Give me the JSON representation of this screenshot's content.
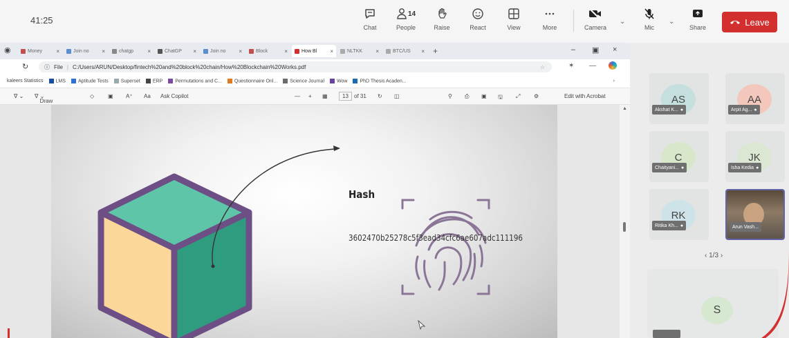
{
  "meeting": {
    "timer": "41:25",
    "controls": [
      {
        "name": "chat",
        "label": "Chat",
        "icon": "chat-icon"
      },
      {
        "name": "people",
        "label": "People",
        "icon": "people-icon",
        "count": "14"
      },
      {
        "name": "raise",
        "label": "Raise",
        "icon": "raise-hand-icon"
      },
      {
        "name": "react",
        "label": "React",
        "icon": "react-icon"
      },
      {
        "name": "view",
        "label": "View",
        "icon": "view-grid-icon"
      },
      {
        "name": "more",
        "label": "More",
        "icon": "more-icon"
      },
      {
        "name": "camera",
        "label": "Camera",
        "icon": "camera-off-icon"
      },
      {
        "name": "mic",
        "label": "Mic",
        "icon": "mic-off-icon"
      },
      {
        "name": "share",
        "label": "Share",
        "icon": "share-icon"
      }
    ],
    "leave_label": "Leave",
    "leave_color": "#d32f2f"
  },
  "browser": {
    "tabs": [
      {
        "label": "Money"
      },
      {
        "label": "Join no"
      },
      {
        "label": "chatgp"
      },
      {
        "label": "ChatGP"
      },
      {
        "label": "Join no"
      },
      {
        "label": "Block"
      },
      {
        "label": "How Bl",
        "active": true
      },
      {
        "label": "NLTKK"
      },
      {
        "label": "BTC/US"
      }
    ],
    "address": "C:/Users/ARUN/Desktop/fintech%20and%20block%20chain/How%20Blockchain%20Works.pdf",
    "address_prefix": "File",
    "favorites": [
      "kaleers Statistics",
      "LMS",
      "Aptitude Tests",
      "Superset",
      "ERP",
      "Permutations and C...",
      "Questionnaire Onl...",
      "Science Journal",
      "Wow",
      "PhD Thesis Acaden..."
    ],
    "pdf_toolbar": {
      "draw_label": "Draw",
      "copilot_label": "Ask Copilot",
      "page_current": "13",
      "page_total": "of 31",
      "acrobat_label": "Edit with Acrobat"
    }
  },
  "slide": {
    "hash_title": "Hash",
    "hash_value": "3602470b25278c5f3ead34cfc6ae607adc111196",
    "cube_colors": {
      "top": "#5fc5a8",
      "left": "#fbd899",
      "right": "#2f9c80",
      "outline": "#6d4f86"
    },
    "fingerprint_color": "#8a7596"
  },
  "participants": {
    "tiles": [
      {
        "initials": "AS",
        "name": "Akshat K...",
        "bg": "#c5dede"
      },
      {
        "initials": "AA",
        "name": "Arpit Ag...",
        "bg": "#f3c7bc"
      },
      {
        "initials": "C",
        "name": "Chaityani...",
        "bg": "#d8e6c9"
      },
      {
        "initials": "JK",
        "name": "Isha Kedia",
        "bg": "#dbe7d2"
      },
      {
        "initials": "RK",
        "name": "Ritika Kh...",
        "bg": "#cde3e8"
      },
      {
        "initials": "",
        "name": "Arun Vash...",
        "bg": "#7a6a56"
      }
    ],
    "pager": "1/3",
    "spotlight_initial": "S"
  }
}
